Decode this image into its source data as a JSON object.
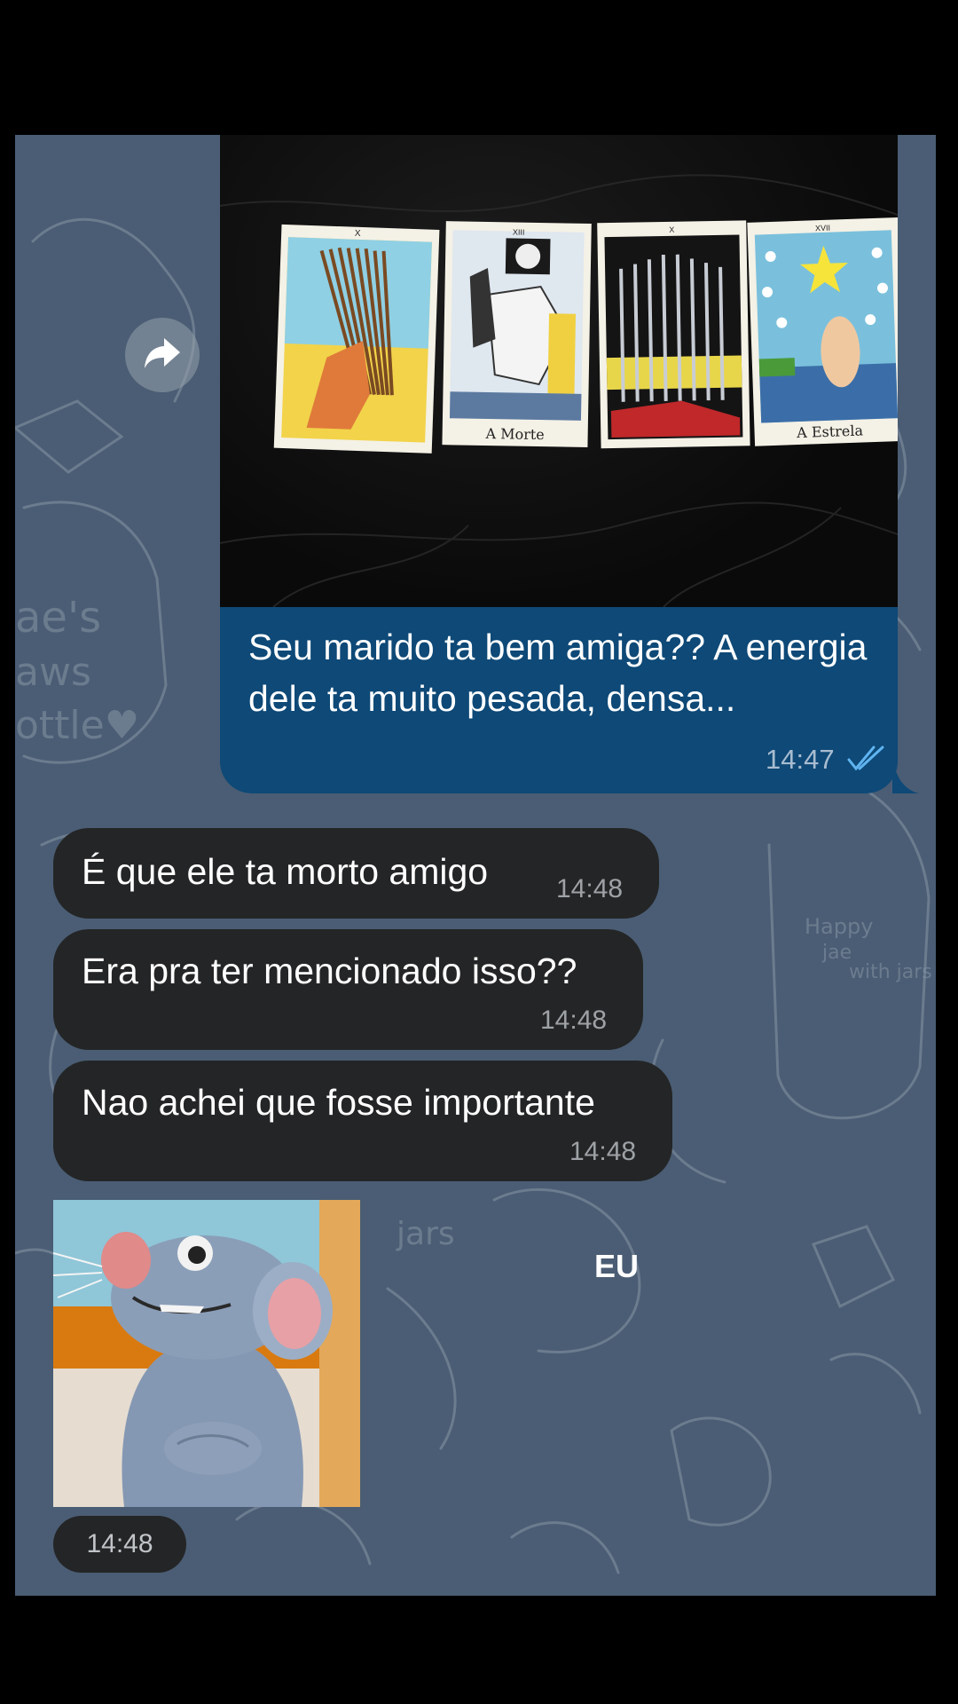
{
  "outgoing": {
    "photo": {
      "cards": [
        {
          "numeral": "X",
          "caption": ""
        },
        {
          "numeral": "XIII",
          "caption": "A Morte"
        },
        {
          "numeral": "X",
          "caption": ""
        },
        {
          "numeral": "XVII",
          "caption": "A Estrela"
        }
      ]
    },
    "text": "Seu marido ta bem amiga?? A energia dele ta muito pesada, densa...",
    "time": "14:47",
    "status_icon": "double-check-icon"
  },
  "incoming": [
    {
      "text": "É que ele ta morto amigo",
      "time": "14:48"
    },
    {
      "text": "Era pra ter mencionado isso??",
      "time": "14:48"
    },
    {
      "text": "Nao achei que fosse importante",
      "time": "14:48"
    }
  ],
  "sticker": {
    "caption": "EU",
    "time": "14:48"
  },
  "colors": {
    "chat_background": "#4a5d74",
    "outgoing_bubble": "#0e4977",
    "incoming_bubble": "#242526",
    "read_ticks": "#5fb4f0"
  }
}
